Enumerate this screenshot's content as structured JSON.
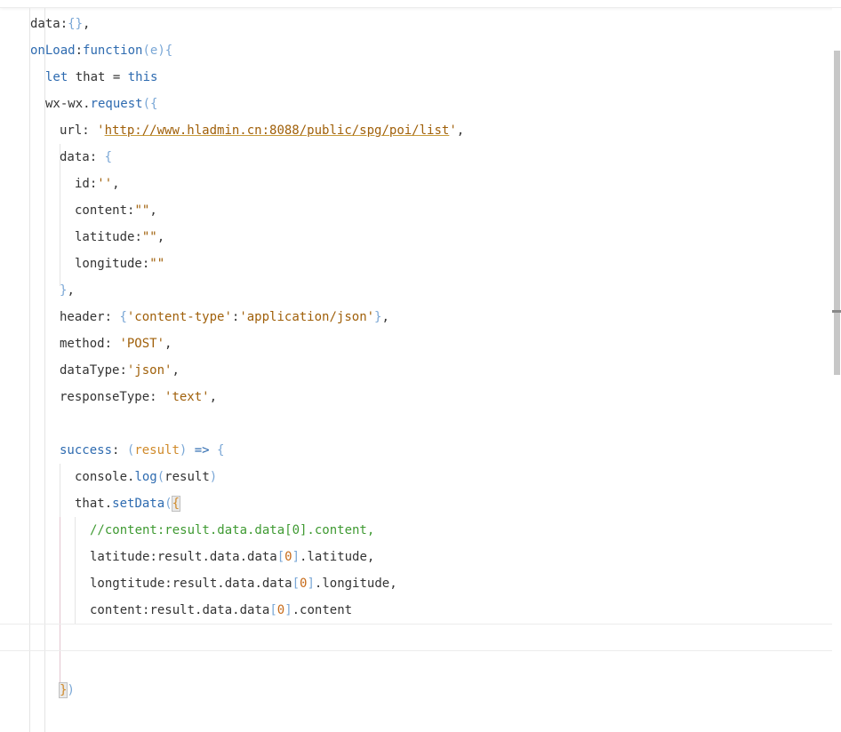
{
  "editor": {
    "lines": [
      [
        {
          "t": "data",
          "c": "prop"
        },
        {
          "t": ":",
          "c": "punc"
        },
        {
          "t": "{}",
          "c": "br1"
        },
        {
          "t": ",",
          "c": "punc"
        }
      ],
      [
        {
          "t": "onLoad",
          "c": "fn"
        },
        {
          "t": ":",
          "c": "punc"
        },
        {
          "t": "function",
          "c": "kw"
        },
        {
          "t": "(",
          "c": "br1"
        },
        {
          "t": "e",
          "c": "br1"
        },
        {
          "t": ")",
          "c": "br1"
        },
        {
          "t": "{",
          "c": "br1"
        }
      ],
      [
        {
          "t": "let",
          "c": "kw"
        },
        {
          "t": " that ",
          "c": "plain"
        },
        {
          "t": "=",
          "c": "punc"
        },
        {
          "t": " ",
          "c": "plain"
        },
        {
          "t": "this",
          "c": "kw"
        }
      ],
      [
        {
          "t": "wx-wx.",
          "c": "plain"
        },
        {
          "t": "request",
          "c": "fn"
        },
        {
          "t": "({",
          "c": "br1"
        }
      ],
      [
        {
          "t": "url",
          "c": "prop"
        },
        {
          "t": ": ",
          "c": "punc"
        },
        {
          "t": "'",
          "c": "str"
        },
        {
          "t": "http://www.hladmin.cn:8088/public/spg/poi/list",
          "c": "url"
        },
        {
          "t": "'",
          "c": "str"
        },
        {
          "t": ",",
          "c": "punc"
        }
      ],
      [
        {
          "t": "data",
          "c": "prop"
        },
        {
          "t": ": ",
          "c": "punc"
        },
        {
          "t": "{",
          "c": "br1"
        }
      ],
      [
        {
          "t": "id",
          "c": "prop"
        },
        {
          "t": ":",
          "c": "punc"
        },
        {
          "t": "''",
          "c": "str"
        },
        {
          "t": ",",
          "c": "punc"
        }
      ],
      [
        {
          "t": "content",
          "c": "prop"
        },
        {
          "t": ":",
          "c": "punc"
        },
        {
          "t": "\"\"",
          "c": "str"
        },
        {
          "t": ",",
          "c": "punc"
        }
      ],
      [
        {
          "t": "latitude",
          "c": "prop"
        },
        {
          "t": ":",
          "c": "punc"
        },
        {
          "t": "\"\"",
          "c": "str"
        },
        {
          "t": ",",
          "c": "punc"
        }
      ],
      [
        {
          "t": "longitude",
          "c": "prop"
        },
        {
          "t": ":",
          "c": "punc"
        },
        {
          "t": "\"\"",
          "c": "str"
        }
      ],
      [
        {
          "t": "}",
          "c": "br1"
        },
        {
          "t": ",",
          "c": "punc"
        }
      ],
      [
        {
          "t": "header",
          "c": "prop"
        },
        {
          "t": ": ",
          "c": "punc"
        },
        {
          "t": "{",
          "c": "br1"
        },
        {
          "t": "'content-type'",
          "c": "str"
        },
        {
          "t": ":",
          "c": "punc"
        },
        {
          "t": "'application/json'",
          "c": "str"
        },
        {
          "t": "}",
          "c": "br1"
        },
        {
          "t": ",",
          "c": "punc"
        }
      ],
      [
        {
          "t": "method",
          "c": "prop"
        },
        {
          "t": ": ",
          "c": "punc"
        },
        {
          "t": "'POST'",
          "c": "str"
        },
        {
          "t": ",",
          "c": "punc"
        }
      ],
      [
        {
          "t": "dataType",
          "c": "prop"
        },
        {
          "t": ":",
          "c": "punc"
        },
        {
          "t": "'json'",
          "c": "str"
        },
        {
          "t": ",",
          "c": "punc"
        }
      ],
      [
        {
          "t": "responseType",
          "c": "prop"
        },
        {
          "t": ": ",
          "c": "punc"
        },
        {
          "t": "'text'",
          "c": "str"
        },
        {
          "t": ",",
          "c": "punc"
        }
      ],
      [],
      [
        {
          "t": "success",
          "c": "fn"
        },
        {
          "t": ": ",
          "c": "punc"
        },
        {
          "t": "(",
          "c": "br1"
        },
        {
          "t": "result",
          "c": "br2"
        },
        {
          "t": ")",
          "c": "br1"
        },
        {
          "t": " => ",
          "c": "kw"
        },
        {
          "t": "{",
          "c": "br1"
        }
      ],
      [
        {
          "t": "console.",
          "c": "plain"
        },
        {
          "t": "log",
          "c": "fn"
        },
        {
          "t": "(",
          "c": "br1"
        },
        {
          "t": "result",
          "c": "plain"
        },
        {
          "t": ")",
          "c": "br1"
        }
      ],
      [
        {
          "t": "that.",
          "c": "plain"
        },
        {
          "t": "setData",
          "c": "fn"
        },
        {
          "t": "(",
          "c": "br1"
        },
        {
          "t": "{",
          "c": "br2",
          "bm": true
        }
      ],
      [
        {
          "t": "//content:result.data.data[0].content,",
          "c": "comment"
        }
      ],
      [
        {
          "t": "latitude",
          "c": "prop"
        },
        {
          "t": ":result.data.data",
          "c": "plain"
        },
        {
          "t": "[",
          "c": "br1"
        },
        {
          "t": "0",
          "c": "num"
        },
        {
          "t": "]",
          "c": "br1"
        },
        {
          "t": ".latitude,",
          "c": "plain"
        }
      ],
      [
        {
          "t": "longtitude",
          "c": "prop"
        },
        {
          "t": ":result.data.data",
          "c": "plain"
        },
        {
          "t": "[",
          "c": "br1"
        },
        {
          "t": "0",
          "c": "num"
        },
        {
          "t": "]",
          "c": "br1"
        },
        {
          "t": ".longitude,",
          "c": "plain"
        }
      ],
      [
        {
          "t": "content",
          "c": "prop"
        },
        {
          "t": ":result.data.data",
          "c": "plain"
        },
        {
          "t": "[",
          "c": "br1"
        },
        {
          "t": "0",
          "c": "num"
        },
        {
          "t": "]",
          "c": "br1"
        },
        {
          "t": ".content",
          "c": "plain"
        }
      ],
      [],
      [],
      [
        {
          "t": "}",
          "c": "br2",
          "bm": true
        },
        {
          "t": ")",
          "c": "br1"
        }
      ]
    ]
  }
}
